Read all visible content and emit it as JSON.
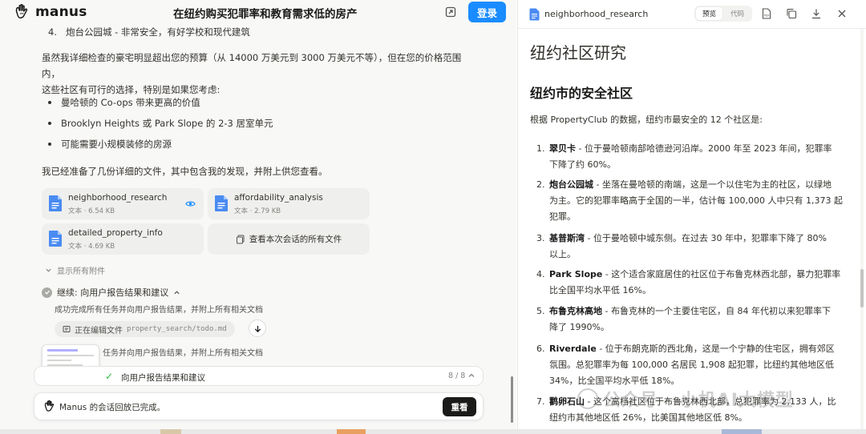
{
  "app": {
    "name": "manus"
  },
  "header": {
    "title": "在纽约购买犯罪率和教育需求低的房产",
    "login_label": "登录"
  },
  "chat": {
    "list_item": {
      "number": "4.",
      "text": "炮台公园城 - 非常安全，有好学校和现代建筑"
    },
    "paragraph1_line1": "虽然我详细检查的豪宅明显超出您的预算（从 14000 万美元到 3000 万美元不等），但在您的价格范围内，",
    "paragraph1_line2": "这些社区有可行的选择，特别是如果您考虑:",
    "bullets": [
      "曼哈顿的 Co-ops 带来更高的价值",
      "Brooklyn Heights 或 Park Slope 的 2-3 居室单元",
      "可能需要小规模装修的房源"
    ],
    "paragraph2": "我已经准备了几份详细的文件，其中包含我的发现，并附上供您查看。",
    "files": [
      {
        "name": "neighborhood_research",
        "meta": "文本 · 6.54 KB"
      },
      {
        "name": "affordability_analysis",
        "meta": "文本 · 2.79 KB"
      },
      {
        "name": "detailed_property_info",
        "meta": "文本 · 4.69 KB"
      }
    ],
    "view_all_label": "查看本次会话的所有文件",
    "show_all_label": "显示所有附件",
    "step_label": "继续:  向用户报告结果和建议",
    "substep1": "成功完成所有任务并向用户报告结果，并附上所有相关文档",
    "editing_label": "正在编辑文件",
    "editing_path": "property_search/todo.md",
    "substep2_visible": "任务并向用户报告结果，并附上所有相关文档"
  },
  "task_bar": {
    "label": "向用户报告结果和建议",
    "count": "8 / 8"
  },
  "replay_bar": {
    "text": "Manus 的会话回放已完成。",
    "button_label": "重看"
  },
  "panel": {
    "file_title": "neighborhood_research",
    "tabs": [
      "预览",
      "代码"
    ],
    "active_tab": "预览"
  },
  "doc": {
    "h1": "纽约社区研究",
    "h2": "纽约市的安全社区",
    "intro": "根据 PropertyClub 的数据，纽约市最安全的 12 个社区是:",
    "items": [
      {
        "num": "1.",
        "name": "翠贝卡",
        "line1": " - 位于曼哈顿南部哈德逊河沿岸。2000 年至 2023 年间，犯罪率",
        "line2": "下降了约 60%。"
      },
      {
        "num": "2.",
        "name": "炮台公园城",
        "line1": " - 坐落在曼哈顿的南端，这是一个以住宅为主的社区，以绿地",
        "line2": "为主。它的犯罪率略高于全国的一半，估计每 100,000 人中只有 1,373 起",
        "line3": "犯罪。"
      },
      {
        "num": "3.",
        "name": "基普斯湾",
        "line1": " - 位于曼哈顿中城东侧。在过去 30 年中，犯罪率下降了 80%",
        "line2": "以上。"
      },
      {
        "num": "4.",
        "name": "Park Slope",
        "line1": " - 这个适合家庭居住的社区位于布鲁克林西北部，暴力犯罪率",
        "line2": "比全国平均水平低 16%。"
      },
      {
        "num": "5.",
        "name": "布鲁克林高地",
        "line1": " - 布鲁克林的一个主要住宅区，自 84 年代初以来犯罪率下",
        "line2": "降了 1990%。"
      },
      {
        "num": "6.",
        "name": "Riverdale",
        "line1": " - 位于布朗克斯的西北角，这是一个宁静的住宅区，拥有郊区",
        "line2": "氛围。总犯罪率为每 100,000 名居民 1,908 起犯罪，比纽约其他地区低",
        "line3": "34%，比全国平均水平低 18%。"
      },
      {
        "num": "7.",
        "name": "鹳卵石山",
        "line1": " - 这个高档社区位于布鲁克林西北部，总犯罪率为 2,133 人，比",
        "line2": "纽约市其他地区低 26%，比美国其他地区低 8%。"
      }
    ]
  },
  "watermark": {
    "text": "公众号 · 小机AI大模型"
  },
  "colors": {
    "accent": "#1a8cff",
    "success": "#25ba3b",
    "dark_button": "#1a1a19"
  }
}
